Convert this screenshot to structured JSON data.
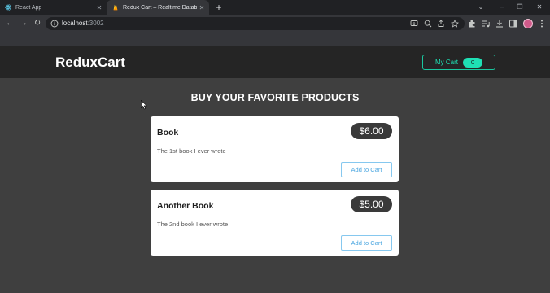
{
  "browser": {
    "tabs": [
      {
        "title": "React App",
        "active": false
      },
      {
        "title": "Redux Cart – Realtime Database",
        "active": true
      }
    ],
    "url_host": "localhost",
    "url_port": ":3002"
  },
  "header": {
    "brand": "ReduxCart",
    "cart_label": "My Cart",
    "cart_count": "0"
  },
  "main": {
    "heading": "BUY YOUR FAVORITE PRODUCTS",
    "products": [
      {
        "name": "Book",
        "price": "$6.00",
        "description": "The 1st book I ever wrote",
        "button_label": "Add to Cart"
      },
      {
        "name": "Another Book",
        "price": "$5.00",
        "description": "The 2nd book I ever wrote",
        "button_label": "Add to Cart"
      }
    ]
  },
  "colors": {
    "page_bg": "#3f3f3f",
    "header_bg": "#252525",
    "accent": "#1fe0b5",
    "button_blue": "#4aa6e0"
  }
}
